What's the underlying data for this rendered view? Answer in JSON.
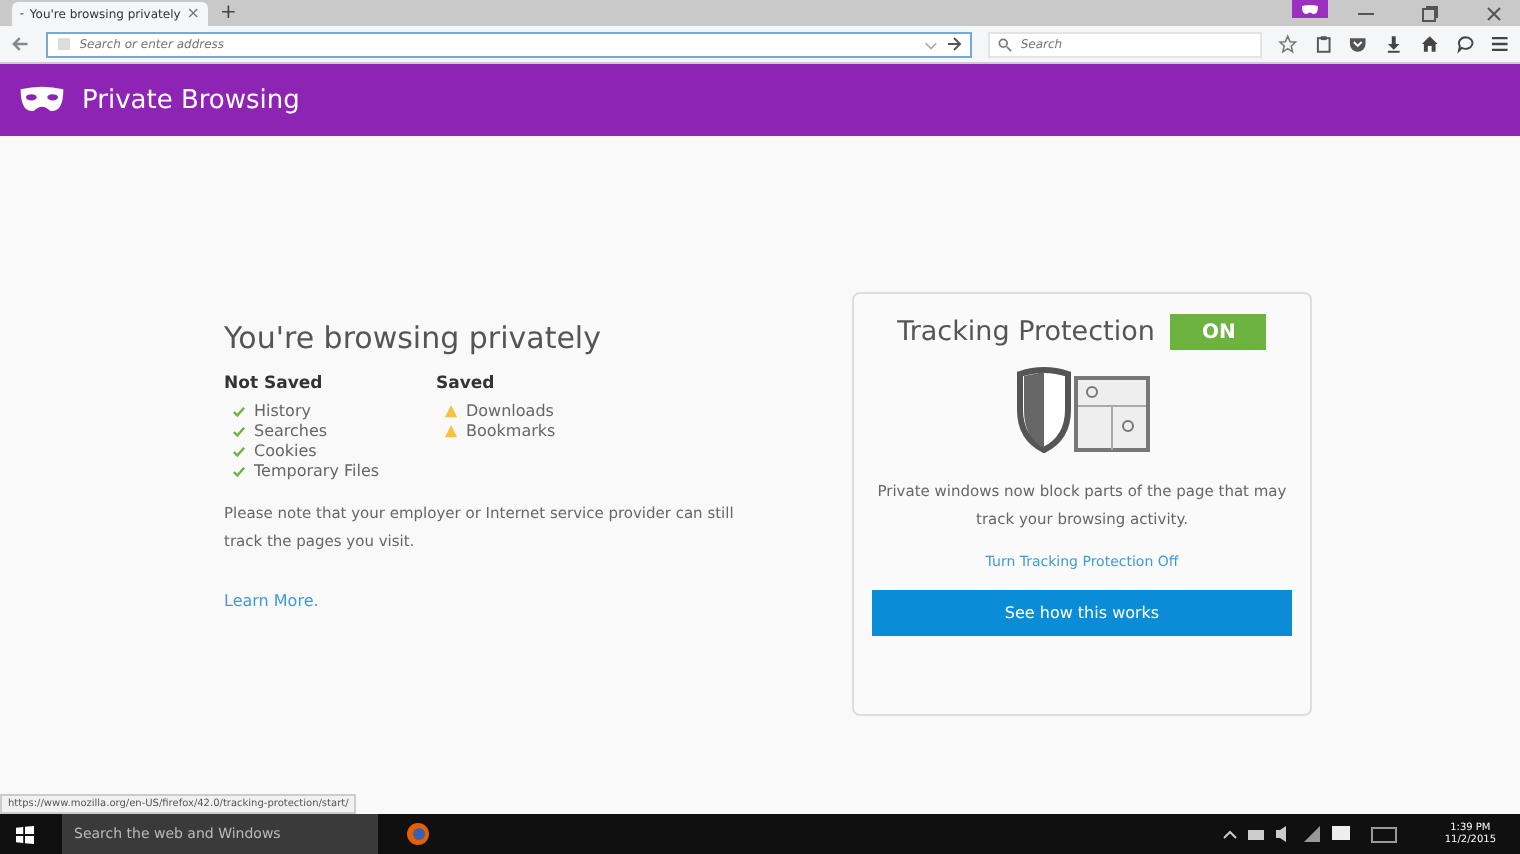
{
  "tab": {
    "title": "You're browsing privately",
    "close": "×"
  },
  "new_tab": "+",
  "address_bar": {
    "placeholder": "Search or enter address"
  },
  "search_bar": {
    "placeholder": "Search"
  },
  "header": {
    "title": "Private Browsing"
  },
  "main": {
    "heading": "You're browsing privately",
    "not_saved": {
      "title": "Not Saved",
      "items": [
        "History",
        "Searches",
        "Cookies",
        "Temporary Files"
      ]
    },
    "saved": {
      "title": "Saved",
      "items": [
        "Downloads",
        "Bookmarks"
      ]
    },
    "note": "Please note that your employer or Internet service provider can still track the pages you visit.",
    "learn_more": "Learn More."
  },
  "tracking": {
    "title": "Tracking Protection",
    "on": true,
    "badge": "ON",
    "description": "Private windows now block parts of the page that may track your browsing activity.",
    "toggle_link": "Turn Tracking Protection Off",
    "button": "See how this works"
  },
  "status_url": "https://www.mozilla.org/en-US/firefox/42.0/tracking-protection/start/",
  "taskbar": {
    "search_placeholder": "Search the web and Windows",
    "time": "1:39 PM",
    "date": "11/2/2015"
  }
}
